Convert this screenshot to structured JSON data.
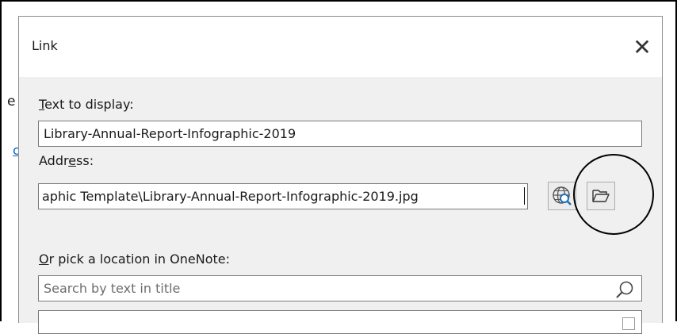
{
  "background": {
    "partial_text": "e",
    "partial_link": "c"
  },
  "dialog": {
    "title": "Link",
    "close_glyph": "✕",
    "text_to_display": {
      "label_prefix": "",
      "label_underlined": "T",
      "label_rest": "ext to display:",
      "value": "Library-Annual-Report-Infographic-2019"
    },
    "address": {
      "label_prefix": "Addr",
      "label_underlined": "e",
      "label_rest": "ss:",
      "value": "aphic Template\\Library-Annual-Report-Infographic-2019.jpg"
    },
    "onenote": {
      "label_underlined": "O",
      "label_rest": "r pick a location in OneNote:",
      "search_placeholder": "Search by text in title"
    }
  },
  "colors": {
    "dialog_bg": "#f0f0f0",
    "link": "#0563c1",
    "annotation": "#000000"
  },
  "icons": [
    "browse-web-icon",
    "open-folder-icon",
    "search-icon",
    "close-icon"
  ]
}
